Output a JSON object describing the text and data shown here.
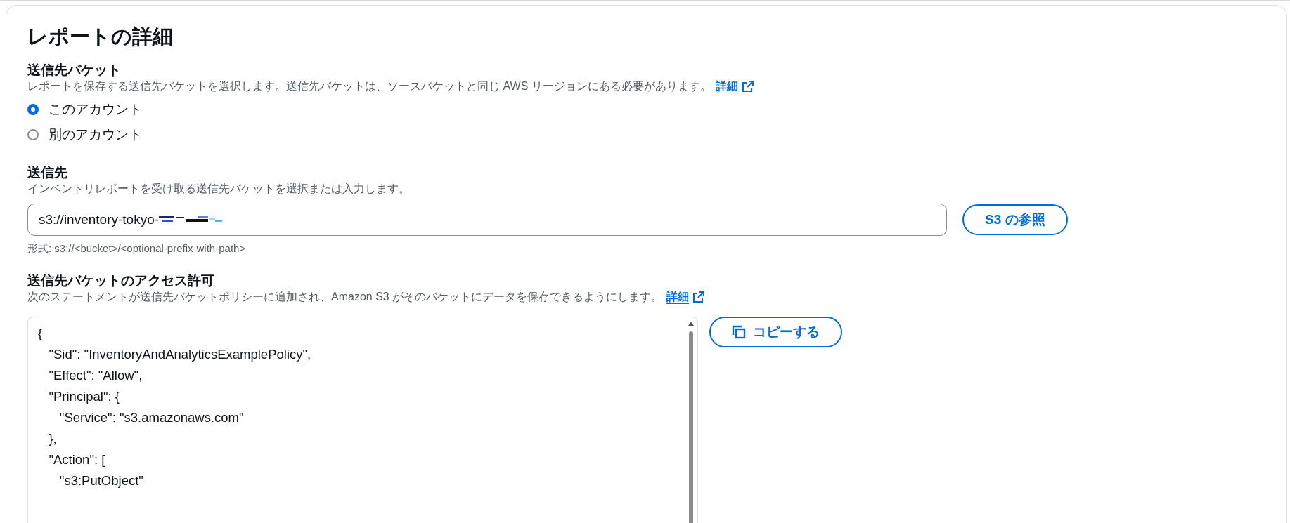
{
  "title": "レポートの詳細",
  "destination_bucket": {
    "label": "送信先バケット",
    "description": "レポートを保存する送信先バケットを選択します。送信先バケットは、ソースバケットと同じ AWS リージョンにある必要があります。",
    "link": "詳細",
    "options": [
      {
        "label": "このアカウント",
        "selected": true
      },
      {
        "label": "別のアカウント",
        "selected": false
      }
    ]
  },
  "destination": {
    "label": "送信先",
    "description": "インベントリレポートを受け取る送信先バケットを選択または入力します。",
    "value": "s3://inventory-tokyo-",
    "browse_button": "S3 の参照",
    "hint": "形式: s3://<bucket>/<optional-prefix-with-path>"
  },
  "permissions": {
    "label": "送信先バケットのアクセス許可",
    "description": "次のステートメントが送信先バケットポリシーに追加され、Amazon S3 がそのバケットにデータを保存できるようにします。",
    "link": "詳細",
    "policy": "{\n   \"Sid\": \"InventoryAndAnalyticsExamplePolicy\",\n   \"Effect\": \"Allow\",\n   \"Principal\": {\n      \"Service\": \"s3.amazonaws.com\"\n   },\n   \"Action\": [\n      \"s3:PutObject\"",
    "copy_button": "コピーする"
  }
}
